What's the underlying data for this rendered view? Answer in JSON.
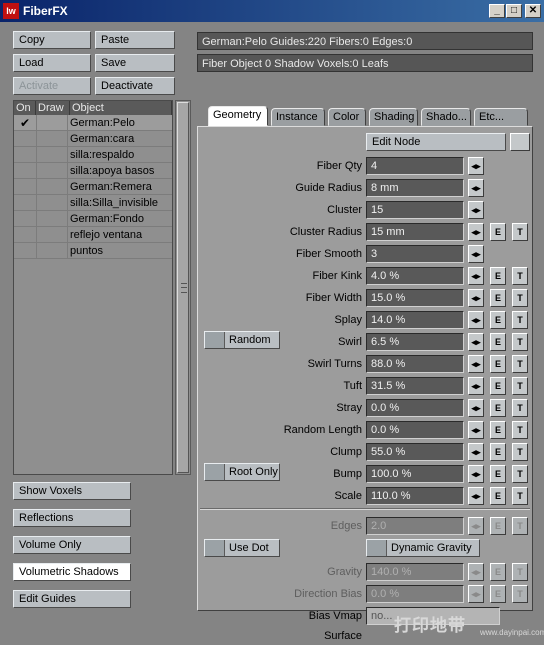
{
  "window": {
    "title": "FiberFX",
    "logo": "lw",
    "controls": [
      "_",
      "□",
      "✕"
    ]
  },
  "left_buttons": {
    "copy": "Copy",
    "paste": "Paste",
    "load": "Load",
    "save": "Save",
    "activate": "Activate",
    "deactivate": "Deactivate"
  },
  "object_list": {
    "headers": [
      "On",
      "Draw",
      "Object"
    ],
    "rows": [
      {
        "on": "✔",
        "name": "German:Pelo",
        "selected": true
      },
      {
        "on": "",
        "name": "German:cara"
      },
      {
        "on": "",
        "name": "silla:respaldo"
      },
      {
        "on": "",
        "name": "silla:apoya basos"
      },
      {
        "on": "",
        "name": "German:Remera"
      },
      {
        "on": "",
        "name": "silla:Silla_invisible"
      },
      {
        "on": "",
        "name": "German:Fondo"
      },
      {
        "on": "",
        "name": "reflejo ventana"
      },
      {
        "on": "",
        "name": "puntos"
      }
    ]
  },
  "bottom_buttons": [
    "Show Voxels",
    "Reflections",
    "Volume Only",
    "Volumetric Shadows",
    "Edit Guides"
  ],
  "info": {
    "line1": "German:Pelo Guides:220 Fibers:0 Edges:0",
    "line2": "Fiber Object 0 Shadow Voxels:0 Leafs"
  },
  "tabs": [
    {
      "label": "Geometry",
      "active": true
    },
    {
      "label": "Instance"
    },
    {
      "label": "Color"
    },
    {
      "label": "Shading"
    },
    {
      "label": "Shado..."
    },
    {
      "label": "Etc..."
    }
  ],
  "edit_node": "Edit Node",
  "params": [
    {
      "label": "Fiber Qty",
      "value": "4",
      "et": false
    },
    {
      "label": "Guide Radius",
      "value": "8 mm",
      "et": false
    },
    {
      "label": "Cluster",
      "value": "15",
      "et": false
    },
    {
      "label": "Cluster Radius",
      "value": "15 mm",
      "et": true
    },
    {
      "label": "Fiber Smooth",
      "value": "3",
      "et": false
    },
    {
      "label": "Fiber Kink",
      "value": "4.0 %",
      "et": true
    },
    {
      "label": "Fiber Width",
      "value": "15.0 %",
      "et": true
    },
    {
      "label": "Splay",
      "value": "14.0 %",
      "et": true
    },
    {
      "label": "Swirl",
      "value": "6.5 %",
      "et": true
    },
    {
      "label": "Swirl Turns",
      "value": "88.0 %",
      "et": true
    },
    {
      "label": "Tuft",
      "value": "31.5 %",
      "et": true
    },
    {
      "label": "Stray",
      "value": "0.0 %",
      "et": true
    },
    {
      "label": "Random Length",
      "value": "0.0 %",
      "et": true
    },
    {
      "label": "Clump",
      "value": "55.0 %",
      "et": true
    },
    {
      "label": "Bump",
      "value": "100.0 %",
      "et": true
    },
    {
      "label": "Scale",
      "value": "110.0 %",
      "et": true
    }
  ],
  "checkboxes": {
    "random": "Random",
    "root_only": "Root Only",
    "use_dot": "Use Dot",
    "dynamic_gravity": "Dynamic Gravity"
  },
  "lower_params": [
    {
      "label": "Edges",
      "value": "2.0",
      "et": true
    },
    {
      "label": "Gravity",
      "value": "140.0 %",
      "et": true
    },
    {
      "label": "Direction Bias",
      "value": "0.0 %",
      "et": true
    }
  ],
  "bias_vmap": {
    "label": "Bias Vmap",
    "value": "no..."
  },
  "surface_label": "Surface",
  "et": {
    "e": "E",
    "t": "T",
    "spin": "◂▸"
  },
  "watermark": {
    "main": "打印地带",
    "sub": "www.dayinpai.com"
  },
  "colors": {
    "titlebar": "#0a246a",
    "panel": "#9c9c9c",
    "field": "#595959"
  }
}
